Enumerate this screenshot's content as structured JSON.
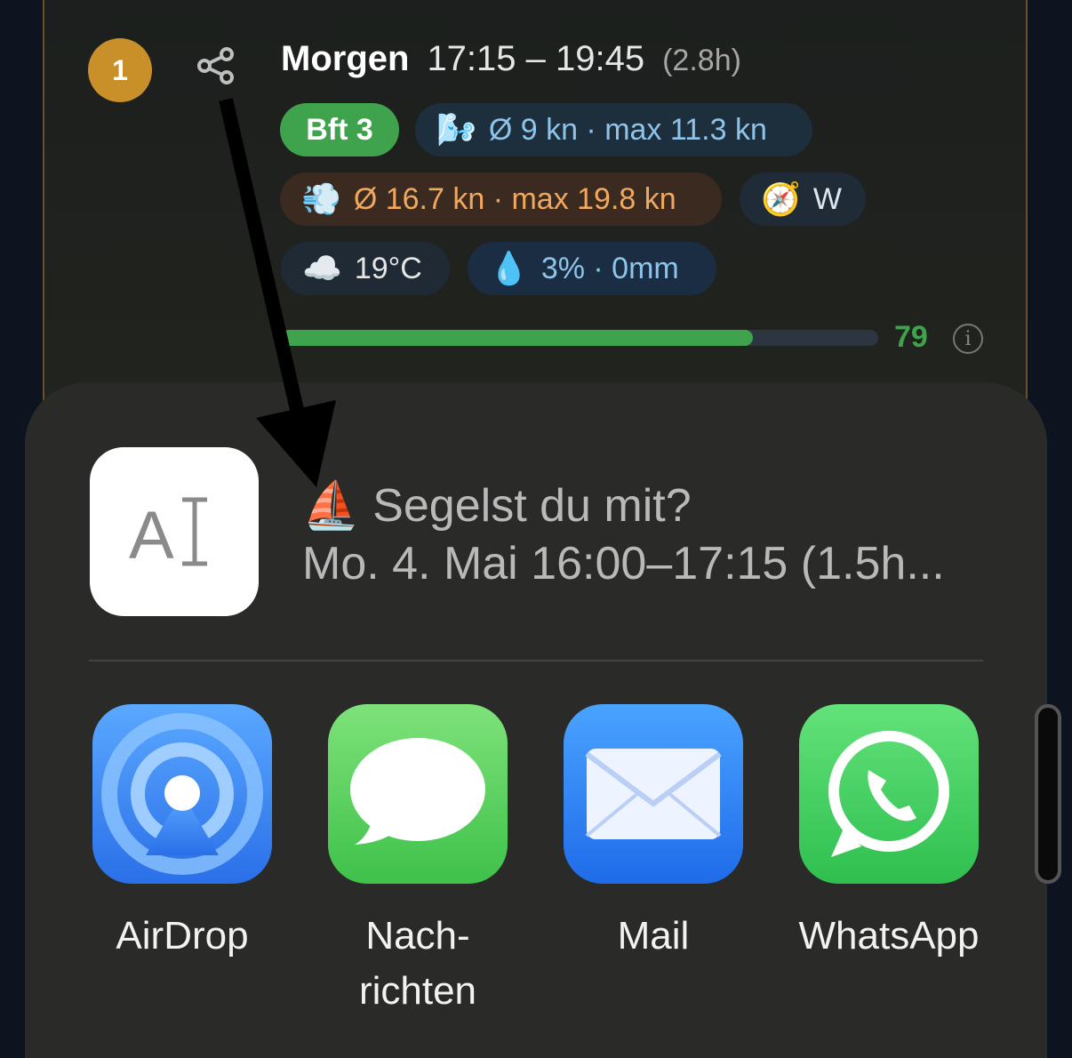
{
  "card": {
    "rank": "1",
    "day": "Morgen",
    "time": "17:15 – 19:45",
    "duration": "(2.8h)",
    "bft": "Bft 3",
    "wind": "Ø 9 kn · max 11.3 kn",
    "gust": "Ø 16.7 kn · max 19.8 kn",
    "direction": "W",
    "temp": "19°C",
    "rain": "3% · 0mm",
    "score": "79",
    "score_fraction": 0.79,
    "info": "i",
    "icons": {
      "share": "share-icon",
      "wind": "wind-face-emoji",
      "gust": "dashing-away-emoji",
      "compass": "compass-emoji",
      "cloud": "cloud-emoji",
      "drop": "droplet-emoji"
    }
  },
  "share_sheet": {
    "preview_icon": "AI",
    "preview_emoji": "⛵",
    "preview_title": "Segelst du mit?",
    "preview_subtitle": "Mo. 4. Mai 16:00–17:15 (1.5h...",
    "apps": [
      {
        "label": "AirDrop"
      },
      {
        "label": "Nach-\nrichten"
      },
      {
        "label": "Mail"
      },
      {
        "label": "WhatsApp"
      }
    ]
  },
  "colors": {
    "accent_green": "#3fa34d",
    "rank_gold": "#c9902a",
    "wind_blue": "#8fc4ea",
    "gust_orange": "#f0a860"
  }
}
